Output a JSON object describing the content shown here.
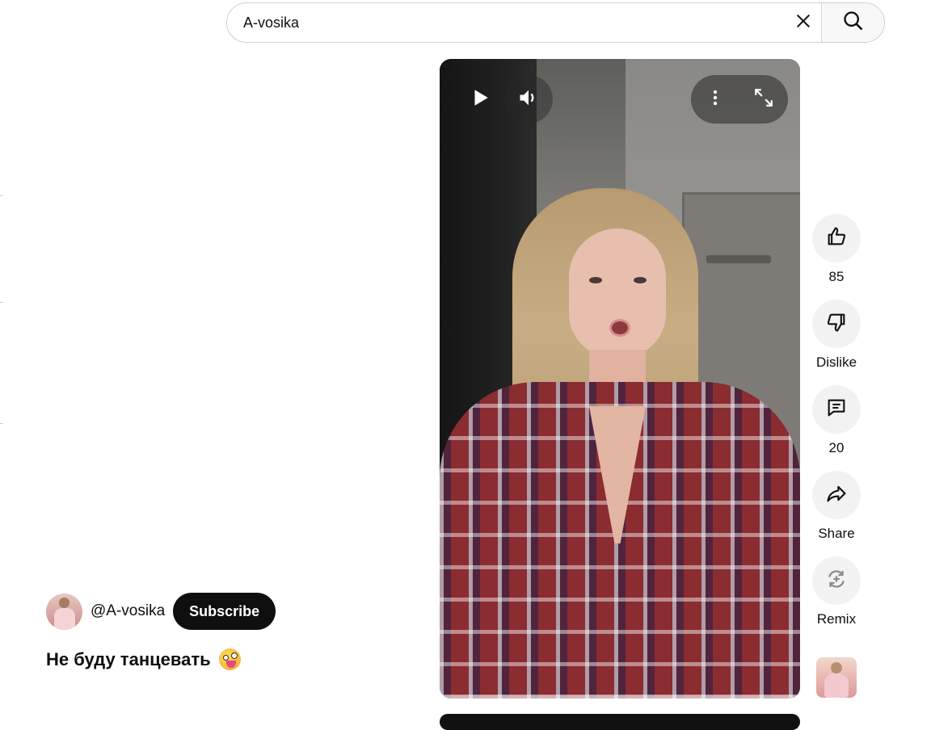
{
  "search": {
    "value": "A-vosika",
    "clear_icon": "close-icon",
    "search_icon": "search-icon"
  },
  "player": {
    "play_icon": "play-icon",
    "volume_icon": "volume-icon",
    "more_icon": "more-vert-icon",
    "fullscreen_icon": "fullscreen-icon",
    "progress": 0
  },
  "actions": {
    "like": {
      "icon": "thumb-up-icon",
      "label": "85"
    },
    "dislike": {
      "icon": "thumb-down-icon",
      "label": "Dislike"
    },
    "comments": {
      "icon": "comment-icon",
      "label": "20"
    },
    "share": {
      "icon": "share-icon",
      "label": "Share"
    },
    "remix": {
      "icon": "remix-icon",
      "label": "Remix"
    }
  },
  "channel": {
    "handle": "@A-vosika",
    "subscribe_label": "Subscribe"
  },
  "video": {
    "title": "Не буду танцевать",
    "title_emoji": "zany-face-emoji"
  },
  "colors": {
    "subscribe_bg": "#0f0f0f",
    "action_bg": "#f2f2f2",
    "text": "#0f0f0f"
  }
}
